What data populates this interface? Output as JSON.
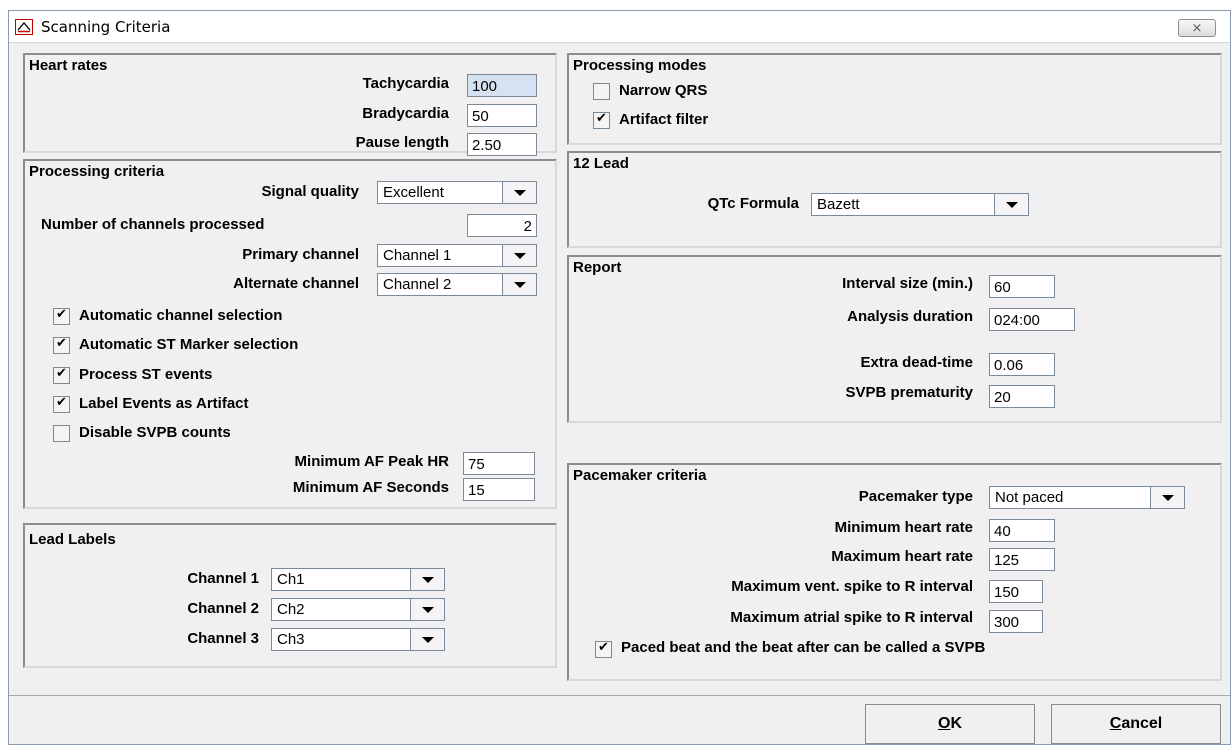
{
  "window": {
    "title": "Scanning Criteria",
    "close_label": "⨯"
  },
  "heart_rates": {
    "title": "Heart rates",
    "tachycardia_label": "Tachycardia",
    "tachycardia_value": "100",
    "bradycardia_label": "Bradycardia",
    "bradycardia_value": "50",
    "pause_label": "Pause length",
    "pause_value": "2.50"
  },
  "processing_criteria": {
    "title": "Processing criteria",
    "signal_quality_label": "Signal quality",
    "signal_quality_value": "Excellent",
    "num_channels_label": "Number of channels processed",
    "num_channels_value": "2",
    "primary_label": "Primary channel",
    "primary_value": "Channel 1",
    "alternate_label": "Alternate channel",
    "alternate_value": "Channel 2",
    "checkboxes": [
      {
        "label": "Automatic channel selection",
        "checked": true
      },
      {
        "label": "Automatic ST Marker selection",
        "checked": true
      },
      {
        "label": "Process ST events",
        "checked": true
      },
      {
        "label": "Label Events as Artifact",
        "checked": true
      },
      {
        "label": "Disable SVPB counts",
        "checked": false
      }
    ],
    "min_af_hr_label": "Minimum AF Peak HR",
    "min_af_hr_value": "75",
    "min_af_sec_label": "Minimum AF Seconds",
    "min_af_sec_value": "15"
  },
  "lead_labels": {
    "title": "Lead Labels",
    "channels": [
      {
        "label": "Channel 1",
        "value": "Ch1"
      },
      {
        "label": "Channel 2",
        "value": "Ch2"
      },
      {
        "label": "Channel 3",
        "value": "Ch3"
      }
    ]
  },
  "processing_modes": {
    "title": "Processing modes",
    "narrow_qrs_label": "Narrow QRS",
    "narrow_qrs_checked": false,
    "artifact_filter_label": "Artifact filter",
    "artifact_filter_checked": true
  },
  "lead12": {
    "title": "12 Lead",
    "qtc_label": "QTc Formula",
    "qtc_value": "Bazett"
  },
  "report": {
    "title": "Report",
    "interval_label": "Interval size (min.)",
    "interval_value": "60",
    "duration_label": "Analysis duration",
    "duration_value": "024:00",
    "dead_time_label": "Extra dead-time",
    "dead_time_value": "0.06",
    "svpb_label": "SVPB prematurity",
    "svpb_value": "20"
  },
  "pacemaker": {
    "title": "Pacemaker criteria",
    "type_label": "Pacemaker type",
    "type_value": "Not paced",
    "min_hr_label": "Minimum heart rate",
    "min_hr_value": "40",
    "max_hr_label": "Maximum heart rate",
    "max_hr_value": "125",
    "vent_label": "Maximum vent. spike  to R interval",
    "vent_value": "150",
    "atrial_label": "Maximum atrial spike to R interval",
    "atrial_value": "300",
    "svpb_label": "Paced beat and the beat after can be called a SVPB",
    "svpb_checked": true
  },
  "footer": {
    "ok_mnemonic": "O",
    "ok_rest": "K",
    "cancel_mnemonic": "C",
    "cancel_rest": "ancel"
  }
}
